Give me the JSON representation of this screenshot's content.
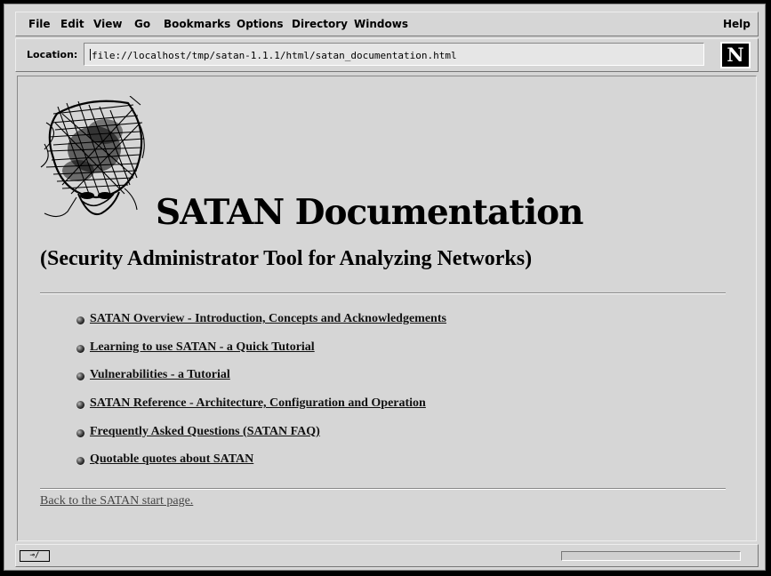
{
  "menubar": {
    "items": [
      "File",
      "Edit",
      "View",
      "Go",
      "Bookmarks",
      "Options",
      "Directory",
      "Windows"
    ],
    "help": "Help"
  },
  "location": {
    "label": "Location:",
    "url": "file://localhost/tmp/satan-1.1.1/html/satan_documentation.html"
  },
  "logo": {
    "letter": "N",
    "icon": "netscape-n-logo"
  },
  "page": {
    "title": "SATAN Documentation",
    "subtitle": "(Security Administrator Tool for Analyzing Networks)",
    "links": [
      "SATAN Overview - Introduction, Concepts and Acknowledgements",
      "Learning to use SATAN - a Quick Tutorial",
      "Vulnerabilities - a Tutorial",
      "SATAN Reference - Architecture, Configuration and Operation",
      "Frequently Asked Questions (SATAN FAQ)",
      "Quotable quotes about SATAN"
    ],
    "back_link": "Back to the SATAN start page."
  },
  "status": {
    "security_icon": "broken-key-icon",
    "progress": 0
  },
  "colors": {
    "chrome": "#d6d6d6",
    "frame": "#000000"
  }
}
